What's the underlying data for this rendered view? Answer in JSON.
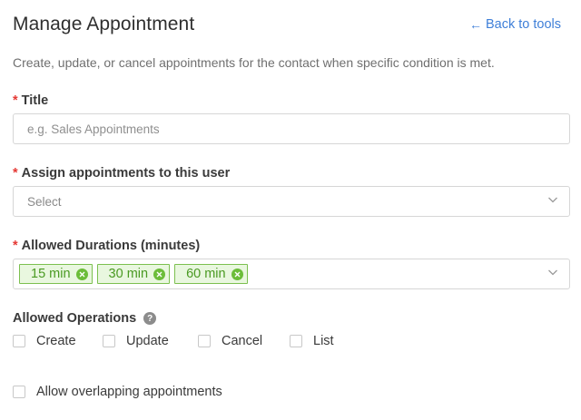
{
  "header": {
    "title": "Manage Appointment",
    "back_link": "Back to tools",
    "back_arrow": "←"
  },
  "description": "Create, update, or cancel appointments for the contact when specific condition is met.",
  "required_marker": "*",
  "title_field": {
    "label": "Title",
    "placeholder": "e.g. Sales Appointments",
    "value": ""
  },
  "assign_field": {
    "label": "Assign appointments to this user",
    "selected": "Select"
  },
  "durations_field": {
    "label": "Allowed Durations (minutes)",
    "tags": [
      "15 min",
      "30 min",
      "60 min"
    ]
  },
  "operations": {
    "label": "Allowed Operations",
    "help_glyph": "?",
    "items": [
      {
        "label": "Create",
        "checked": false
      },
      {
        "label": "Update",
        "checked": false
      },
      {
        "label": "Cancel",
        "checked": false
      },
      {
        "label": "List",
        "checked": false
      }
    ]
  },
  "overlap": {
    "label": "Allow overlapping appointments",
    "checked": false
  },
  "colors": {
    "link": "#3f7fd8",
    "required": "#e53935",
    "tag_bg": "#e9f7df",
    "tag_border": "#7cc04f",
    "tag_text": "#4a9a22"
  }
}
